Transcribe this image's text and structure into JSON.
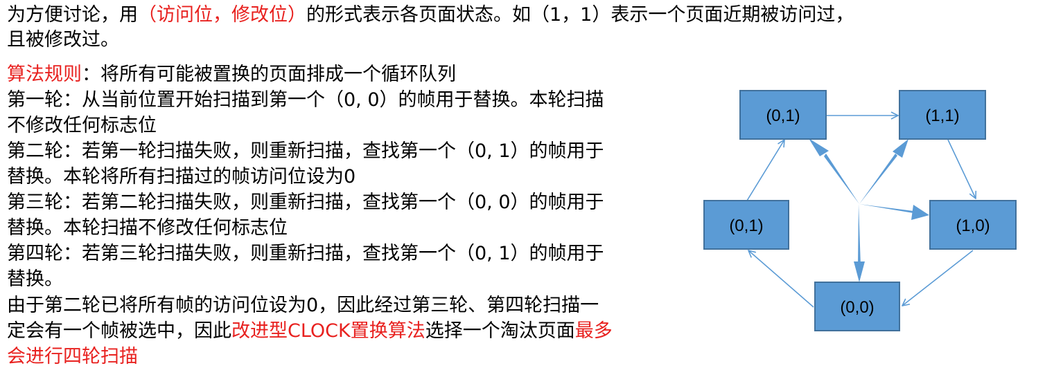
{
  "intro": {
    "l1_a": "为方便讨论，用",
    "l1_red": "（访问位，修改位）",
    "l1_b": "的形式表示各页面状态。如（1，1）表示一个页面近期被访问过，",
    "l2": "且被修改过。"
  },
  "rules": {
    "head_red": "算法规则",
    "head_rest": "：将所有可能被置换的页面排成一个循环队列",
    "r1_l1": "第一轮：从当前位置开始扫描到第一个（0, 0）的帧用于替换。本轮扫描",
    "r1_l2": "不修改任何标志位",
    "r2_l1": "第二轮：若第一轮扫描失败，则重新扫描，查找第一个（0, 1）的帧用于",
    "r2_l2": "替换。本轮将所有扫描过的帧访问位设为0",
    "r3_l1": "第三轮：若第二轮扫描失败，则重新扫描，查找第一个（0, 0）的帧用于",
    "r3_l2": "替换。本轮扫描不修改任何标志位",
    "r4_l1": "第四轮：若第三轮扫描失败，则重新扫描，查找第一个（0, 1）的帧用于",
    "r4_l2": "替换。"
  },
  "conclusion": {
    "l1": "由于第二轮已将所有帧的访问位设为0，因此经过第三轮、第四轮扫描一",
    "l2_a": "定会有一个帧被选中，因此",
    "l2_red": "改进型CLOCK置换算法",
    "l2_b": "选择一个淘汰页面",
    "l2_red2": "最多",
    "l3_red": "会进行四轮扫描"
  },
  "diagram": {
    "node_top_left": "(0,1)",
    "node_top_right": "(1,1)",
    "node_left": "(0,1)",
    "node_right": "(1,0)",
    "node_bottom": "(0,0)"
  },
  "colors": {
    "highlight_red": "#e8211f",
    "node_fill": "#5b9bd5",
    "node_border": "#41719c",
    "arrow": "#5b9bd5"
  }
}
